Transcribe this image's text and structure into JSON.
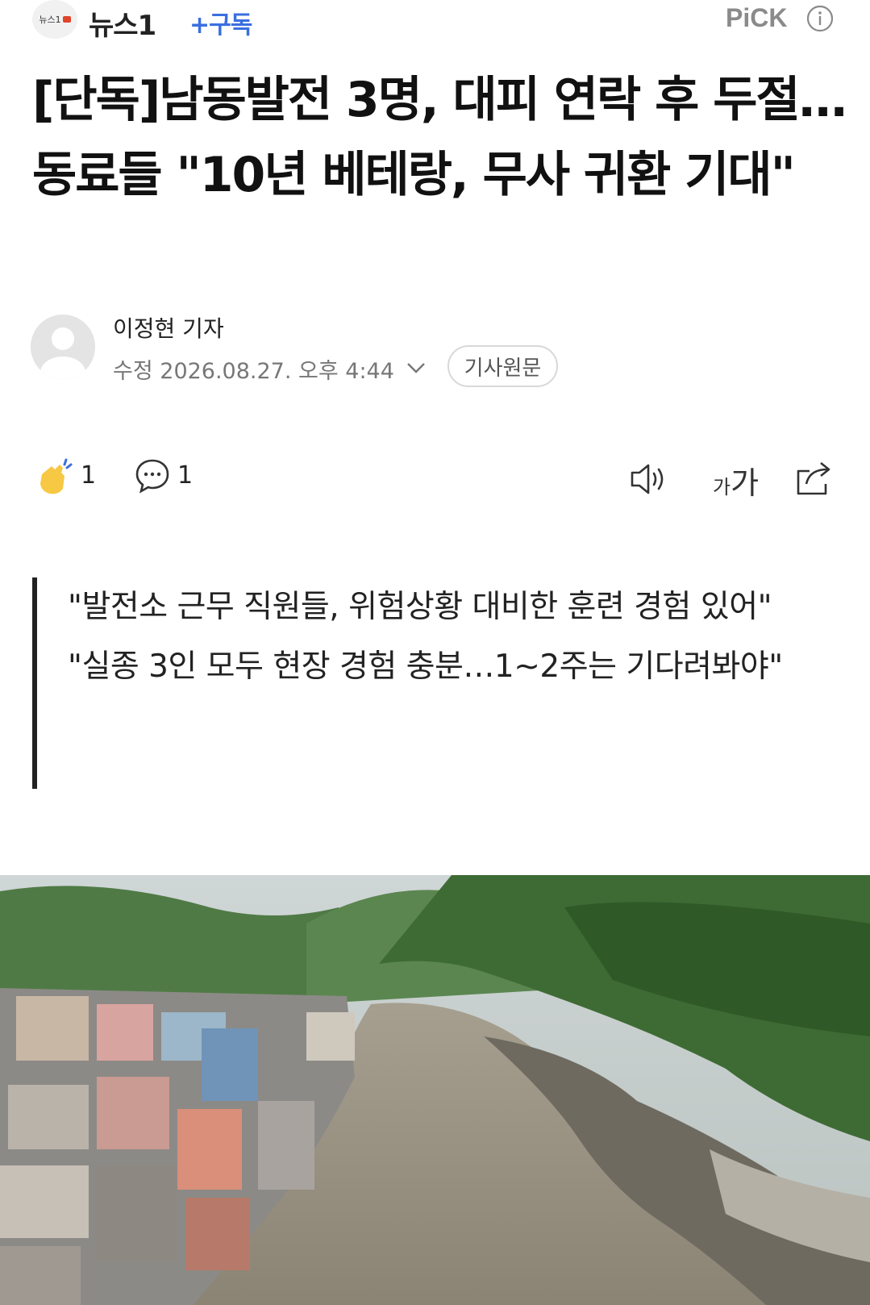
{
  "header": {
    "logo_text": "뉴스1",
    "press_name": "뉴스1",
    "subscribe_label": "+구독",
    "pick_label": "PiCK"
  },
  "article": {
    "title": "[단독]남동발전 3명, 대피 연락 후 두절…동료들 \"10년 베테랑, 무사 귀환 기대\"",
    "reporter": "이정현 기자",
    "date": "수정 2026.08.27. 오후 4:44",
    "original_button": "기사원문"
  },
  "actions": {
    "like_count": "1",
    "comment_count": "1",
    "font_small": "가",
    "font_large": "가"
  },
  "summary": {
    "lines": [
      "\"발전소 근무 직원들, 위험상황 대비한 훈련 경험 있어\"",
      "\"실종 3인 모두 현장 경험 충분…1~2주는 기다려봐야\""
    ]
  },
  "photo": {
    "subject": "flooded river valley with damaged town"
  },
  "icons": {
    "info": "info-icon",
    "like": "clap-like-icon",
    "comment": "comment-bubble-icon",
    "speaker": "speaker-icon",
    "font": "font-size-icon",
    "share": "share-icon"
  },
  "colors": {
    "subscribe": "#3a6fe0",
    "pick": "#8a8a8a",
    "logo_accent": "#e0442a",
    "like": "#f7c843"
  }
}
